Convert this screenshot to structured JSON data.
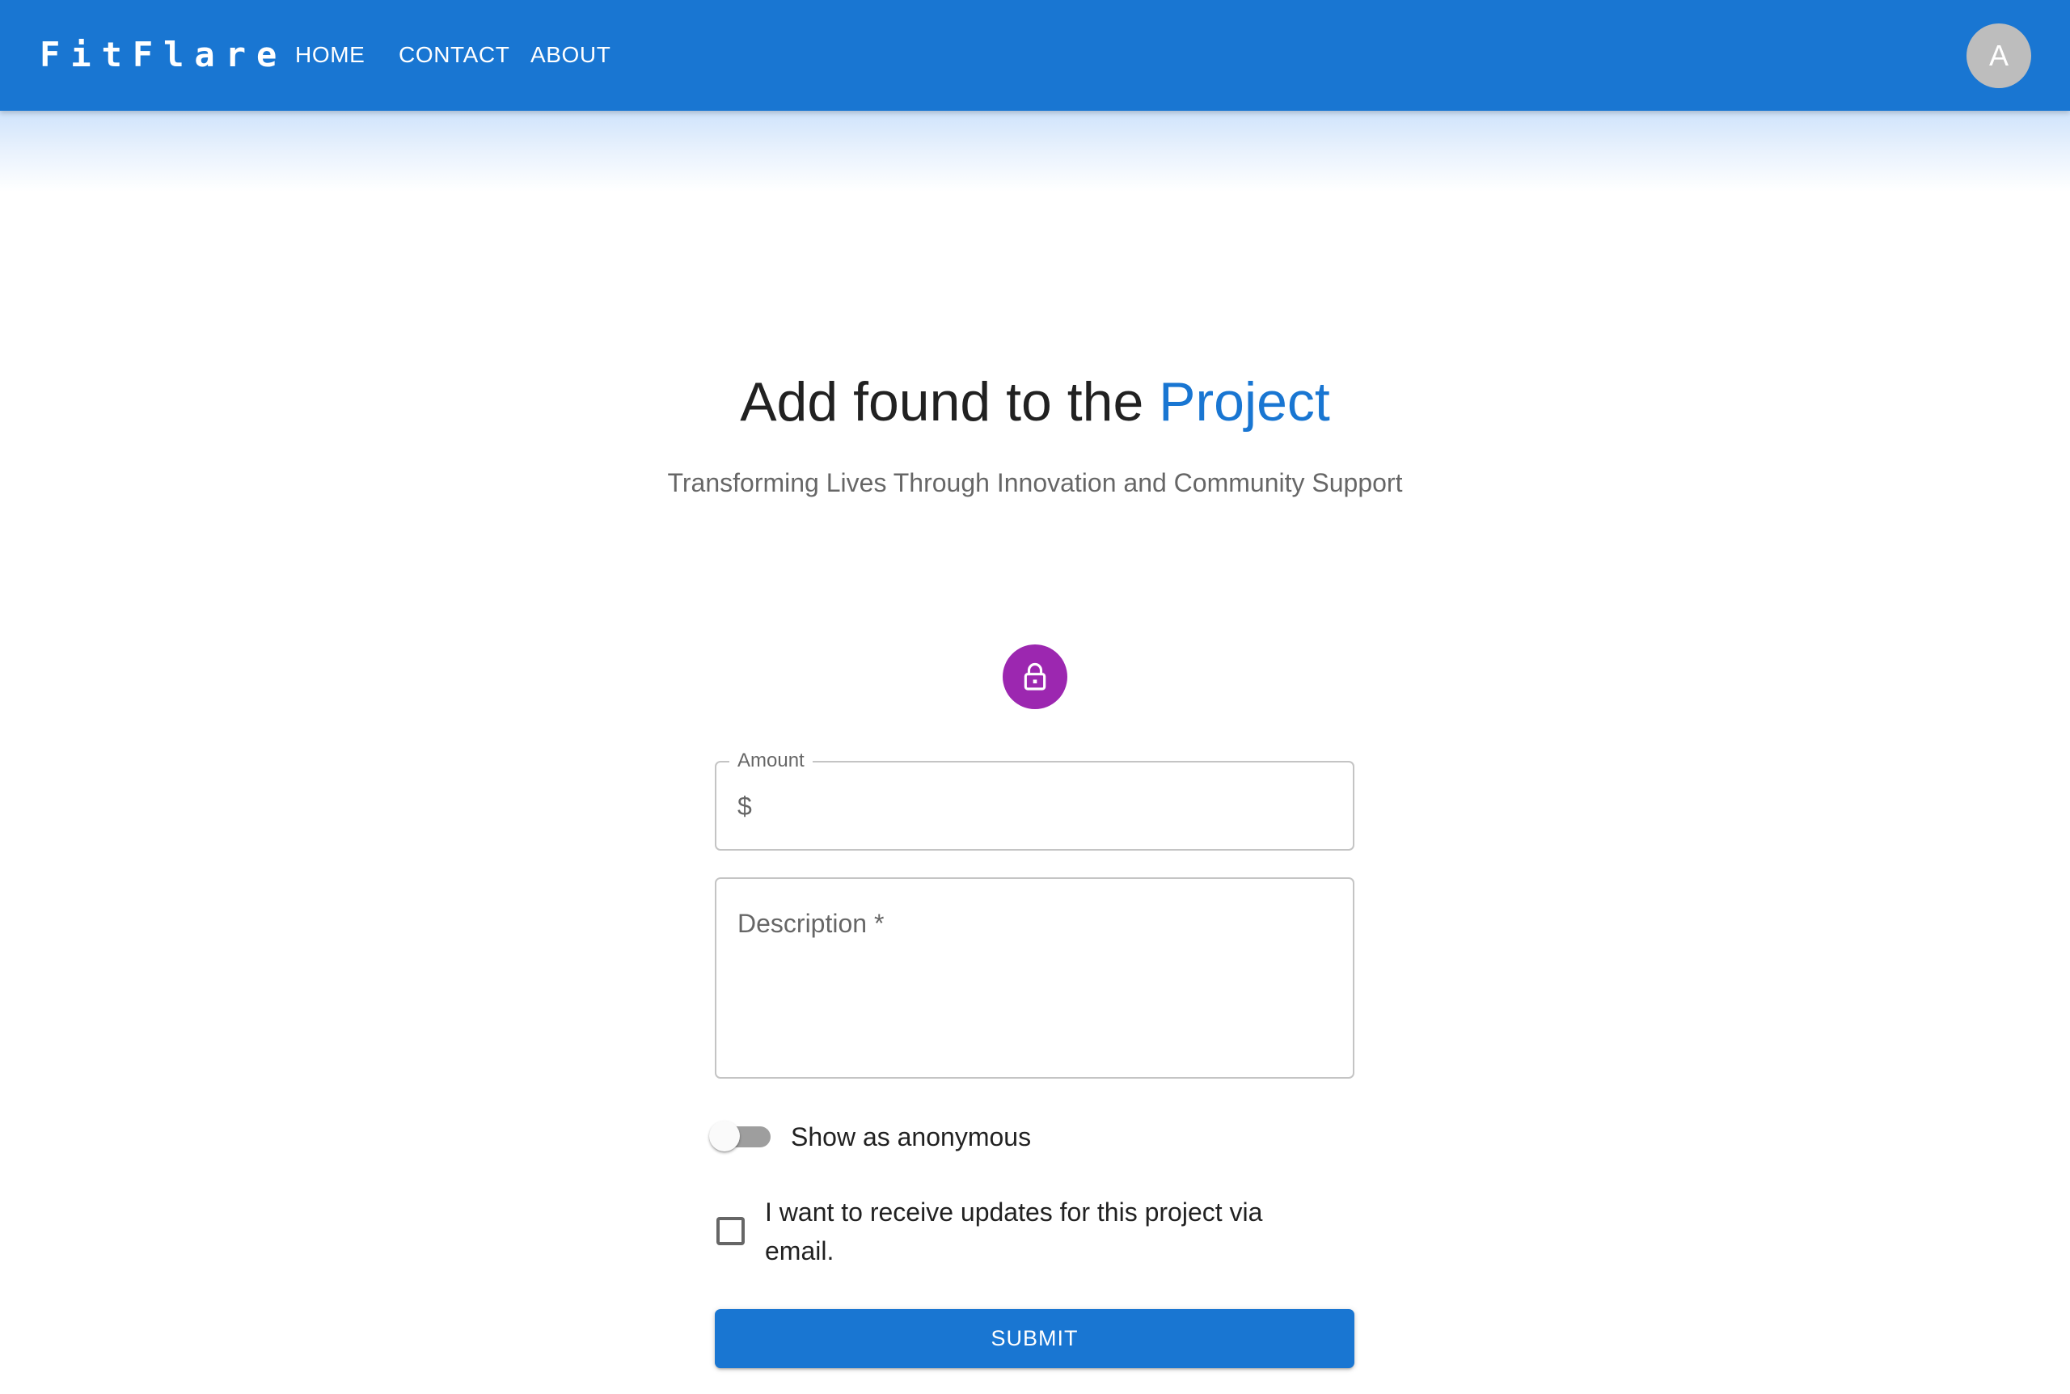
{
  "header": {
    "logo": "FitFlare",
    "nav": {
      "home": "HOME",
      "contact": "CONTACT",
      "about": "ABOUT"
    },
    "avatar_initial": "A",
    "background_color": "#1976d2"
  },
  "hero": {
    "title_main": "Add found to the ",
    "title_accent": "Project",
    "subtitle": "Transforming Lives Through Innovation and Community Support",
    "accent_color": "#1976d2"
  },
  "form": {
    "icon": "lock-icon",
    "icon_bg_color": "#9c27b0",
    "amount": {
      "label": "Amount",
      "adornment": "$",
      "value": ""
    },
    "description": {
      "placeholder": "Description *",
      "value": ""
    },
    "anonymous_switch": {
      "label": "Show as anonymous",
      "checked": false
    },
    "updates_checkbox": {
      "label": "I want to receive updates for this project via email.",
      "checked": false
    },
    "submit_label": "SUBMIT"
  }
}
